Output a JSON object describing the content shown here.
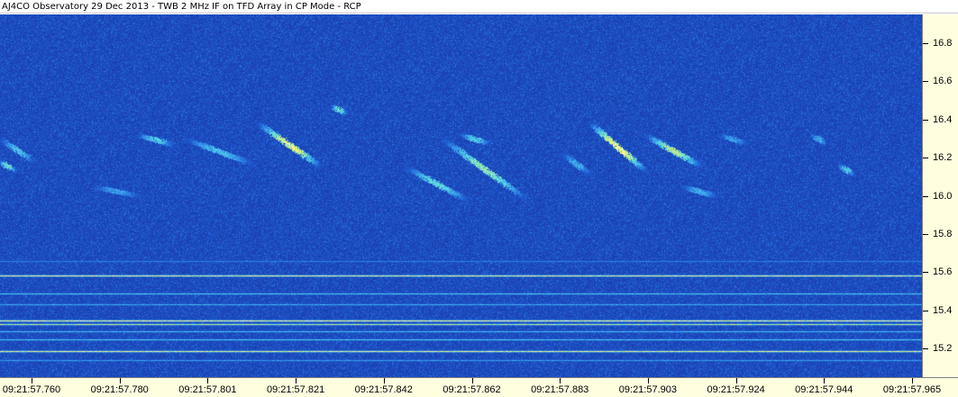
{
  "window": {
    "title": "AJ4CO Observatory 29 Dec 2013 - TWB 2 MHz IF on TFD Array in CP Mode - RCP"
  },
  "chart_data": {
    "type": "heatmap",
    "title": "AJ4CO Observatory 29 Dec 2013 - TWB 2 MHz IF on TFD Array in CP Mode - RCP",
    "xlabel": "",
    "ylabel": "",
    "x_ticks": [
      "09:21:57.760",
      "09:21:57.780",
      "09:21:57.801",
      "09:21:57.821",
      "09:21:57.842",
      "09:21:57.862",
      "09:21:57.883",
      "09:21:57.903",
      "09:21:57.924",
      "09:21:57.944",
      "09:21:57.965"
    ],
    "y_ticks": [
      16.8,
      16.6,
      16.4,
      16.2,
      16.0,
      15.8,
      15.6,
      15.4,
      15.2
    ],
    "ylim": [
      15.05,
      16.95
    ],
    "y_label_format": "fixed1",
    "grid": false,
    "colormap": [
      "#1a3fb0",
      "#1e5ad0",
      "#3aa0f0",
      "#60e0e0",
      "#f0f060",
      "#ffffff"
    ],
    "noise_floor_color": "#1a3fb0",
    "bursts": [
      {
        "x0": 0.0,
        "x1": 0.05,
        "y0": 16.3,
        "y1": 16.14,
        "intensity": 0.55
      },
      {
        "x0": 0.0,
        "x1": 0.02,
        "y0": 16.18,
        "y1": 16.12,
        "intensity": 0.7
      },
      {
        "x0": 0.1,
        "x1": 0.17,
        "y0": 16.05,
        "y1": 15.98,
        "intensity": 0.45
      },
      {
        "x0": 0.15,
        "x1": 0.2,
        "y0": 16.32,
        "y1": 16.25,
        "intensity": 0.6
      },
      {
        "x0": 0.2,
        "x1": 0.3,
        "y0": 16.3,
        "y1": 16.12,
        "intensity": 0.55
      },
      {
        "x0": 0.28,
        "x1": 0.37,
        "y0": 16.38,
        "y1": 16.08,
        "intensity": 0.9
      },
      {
        "x0": 0.36,
        "x1": 0.38,
        "y0": 16.47,
        "y1": 16.42,
        "intensity": 0.7
      },
      {
        "x0": 0.44,
        "x1": 0.53,
        "y0": 16.15,
        "y1": 15.92,
        "intensity": 0.65
      },
      {
        "x0": 0.48,
        "x1": 0.6,
        "y0": 16.3,
        "y1": 15.88,
        "intensity": 0.75
      },
      {
        "x0": 0.5,
        "x1": 0.54,
        "y0": 16.32,
        "y1": 16.26,
        "intensity": 0.6
      },
      {
        "x0": 0.61,
        "x1": 0.65,
        "y0": 16.22,
        "y1": 16.08,
        "intensity": 0.5
      },
      {
        "x0": 0.64,
        "x1": 0.72,
        "y0": 16.38,
        "y1": 16.05,
        "intensity": 0.95
      },
      {
        "x0": 0.7,
        "x1": 0.78,
        "y0": 16.32,
        "y1": 16.1,
        "intensity": 0.8
      },
      {
        "x0": 0.74,
        "x1": 0.79,
        "y0": 16.05,
        "y1": 15.98,
        "intensity": 0.5
      },
      {
        "x0": 0.78,
        "x1": 0.82,
        "y0": 16.32,
        "y1": 16.26,
        "intensity": 0.45
      },
      {
        "x0": 0.88,
        "x1": 0.9,
        "y0": 16.32,
        "y1": 16.26,
        "intensity": 0.5
      },
      {
        "x0": 0.91,
        "x1": 0.93,
        "y0": 16.16,
        "y1": 16.1,
        "intensity": 0.6
      }
    ],
    "horizontal_lines": [
      {
        "freq": 15.66,
        "intensity": 0.35
      },
      {
        "freq": 15.585,
        "intensity": 0.95
      },
      {
        "freq": 15.49,
        "intensity": 0.6
      },
      {
        "freq": 15.43,
        "intensity": 0.5
      },
      {
        "freq": 15.345,
        "intensity": 1.0
      },
      {
        "freq": 15.33,
        "intensity": 0.85
      },
      {
        "freq": 15.29,
        "intensity": 0.55
      },
      {
        "freq": 15.25,
        "intensity": 0.6
      },
      {
        "freq": 15.185,
        "intensity": 0.95
      },
      {
        "freq": 15.14,
        "intensity": 0.45
      }
    ]
  }
}
